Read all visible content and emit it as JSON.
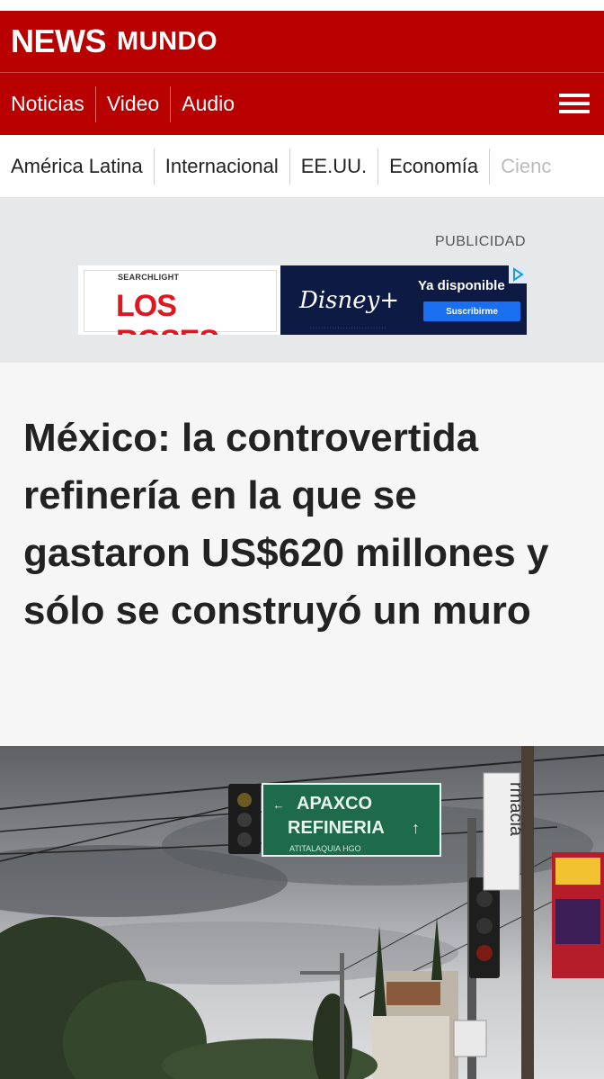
{
  "brand": {
    "news": "NEWS",
    "mundo": "MUNDO"
  },
  "nav": {
    "items": [
      {
        "label": "Noticias"
      },
      {
        "label": "Video"
      },
      {
        "label": "Audio"
      }
    ],
    "menu_icon": "hamburger-menu-icon"
  },
  "sections": {
    "items": [
      {
        "label": "América Latina"
      },
      {
        "label": "Internacional"
      },
      {
        "label": "EE.UU."
      },
      {
        "label": "Economía"
      },
      {
        "label": "Cienc"
      }
    ]
  },
  "ad": {
    "label": "PUBLICIDAD",
    "studio": "SEARCHLIGHT",
    "title": "LOS ROSES",
    "brand": "Disney+",
    "availability": "Ya disponible",
    "cta": "Suscribirme",
    "badge_icon": "adchoices-icon"
  },
  "article": {
    "headline": "México: la controvertida refinería en la que se gastaron US$620 millones y sólo se construyó un muro"
  },
  "photo": {
    "sign_line1": "APAXCO",
    "sign_line2": "REFINERIA",
    "sign_line3": "ATITALAQUIA HGO",
    "shop_sign": "rmacia"
  },
  "colors": {
    "brand_red": "#b80000",
    "headline": "#222222",
    "ad_bg": "#e6e8ea"
  }
}
